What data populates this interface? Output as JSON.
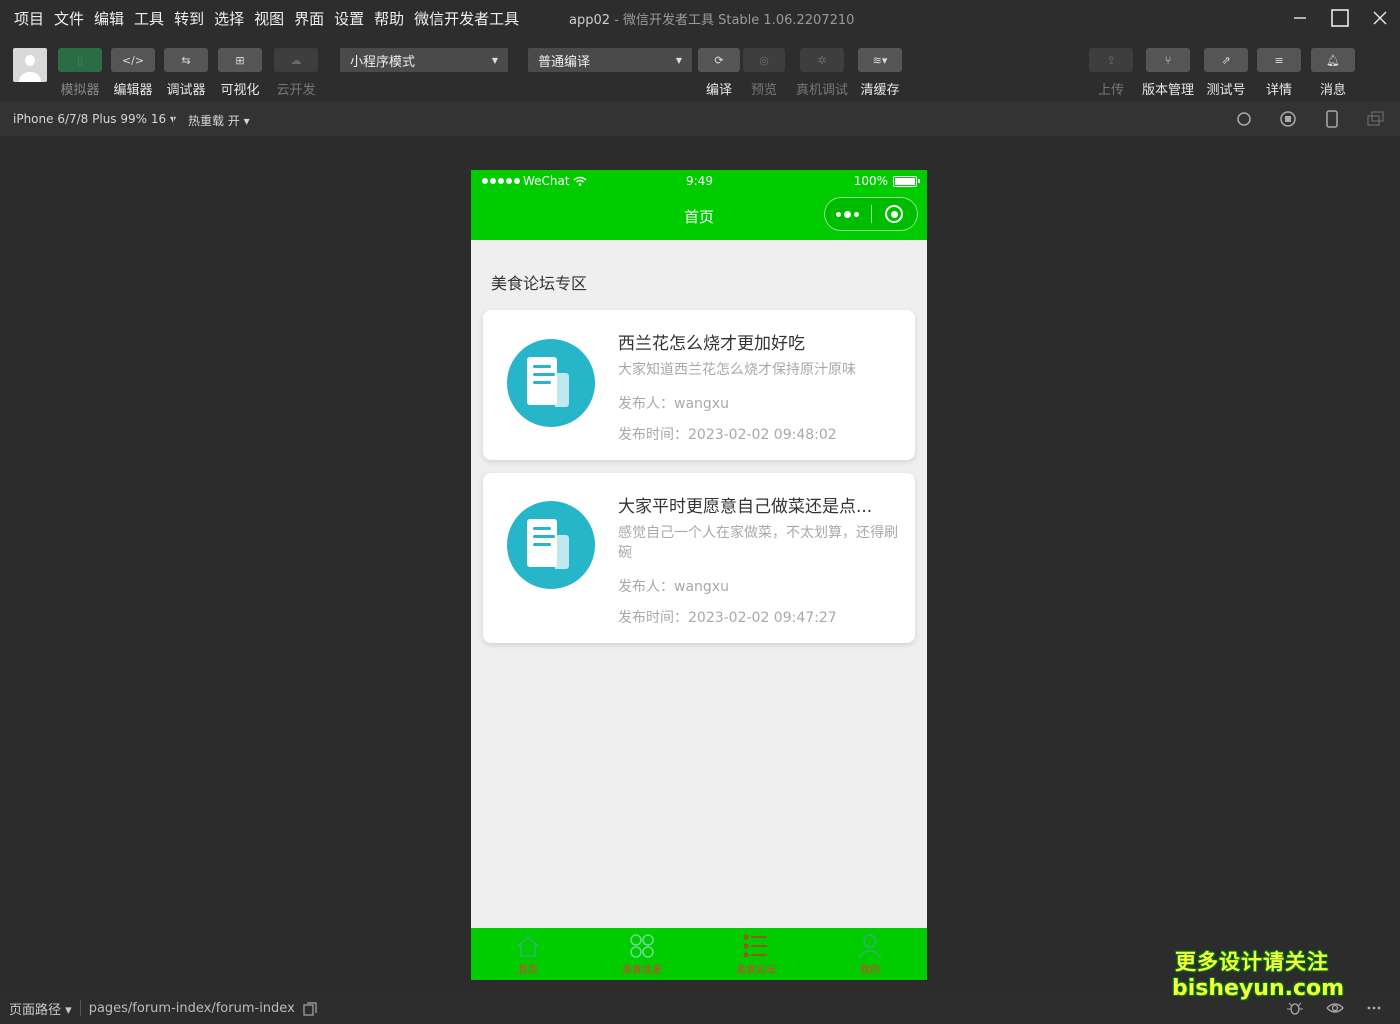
{
  "menu": [
    "项目",
    "文件",
    "编辑",
    "工具",
    "转到",
    "选择",
    "视图",
    "界面",
    "设置",
    "帮助",
    "微信开发者工具"
  ],
  "window": {
    "app_name": "app02",
    "title_rest": " - 微信开发者工具 Stable 1.06.2207210"
  },
  "toolbar": {
    "simulator": "模拟器",
    "editor": "编辑器",
    "debugger": "调试器",
    "visual": "可视化",
    "cloud": "云开发",
    "mode_select": "小程序模式",
    "compile_select": "普通编译",
    "compile": "编译",
    "preview": "预览",
    "real_debug": "真机调试",
    "clear_cache": "清缓存",
    "upload": "上传",
    "version": "版本管理",
    "test_account": "测试号",
    "details": "详情",
    "messages": "消息"
  },
  "subbar": {
    "device": "iPhone 6/7/8 Plus 99% 16",
    "hot_reload": "热重载 开"
  },
  "phone": {
    "status": {
      "carrier": "WeChat",
      "time": "9:49",
      "battery": "100%"
    },
    "nav_title": "首页",
    "section_title": "美食论坛专区",
    "posts": [
      {
        "title": "西兰花怎么烧才更加好吃",
        "desc": "大家知道西兰花怎么烧才保持原汁原味",
        "author": "发布人：wangxu",
        "time": "发布时间：2023-02-02 09:48:02"
      },
      {
        "title": "大家平时更愿意自己做菜还是点...",
        "desc": "感觉自己一个人在家做菜，不太划算，还得刷碗",
        "author": "发布人：wangxu",
        "time": "发布时间：2023-02-02 09:47:27"
      }
    ],
    "tabs": [
      "首页",
      "美食信息",
      "美食论坛",
      "我的"
    ],
    "colors": {
      "accent": "#00cc00",
      "tab_label": "#e53935",
      "thumb": "#26b5c9"
    }
  },
  "bottombar": {
    "path_label": "页面路径",
    "path": "pages/forum-index/forum-index"
  },
  "watermark": {
    "line1": "更多设计请关注",
    "line2": "bisheyun.com"
  }
}
